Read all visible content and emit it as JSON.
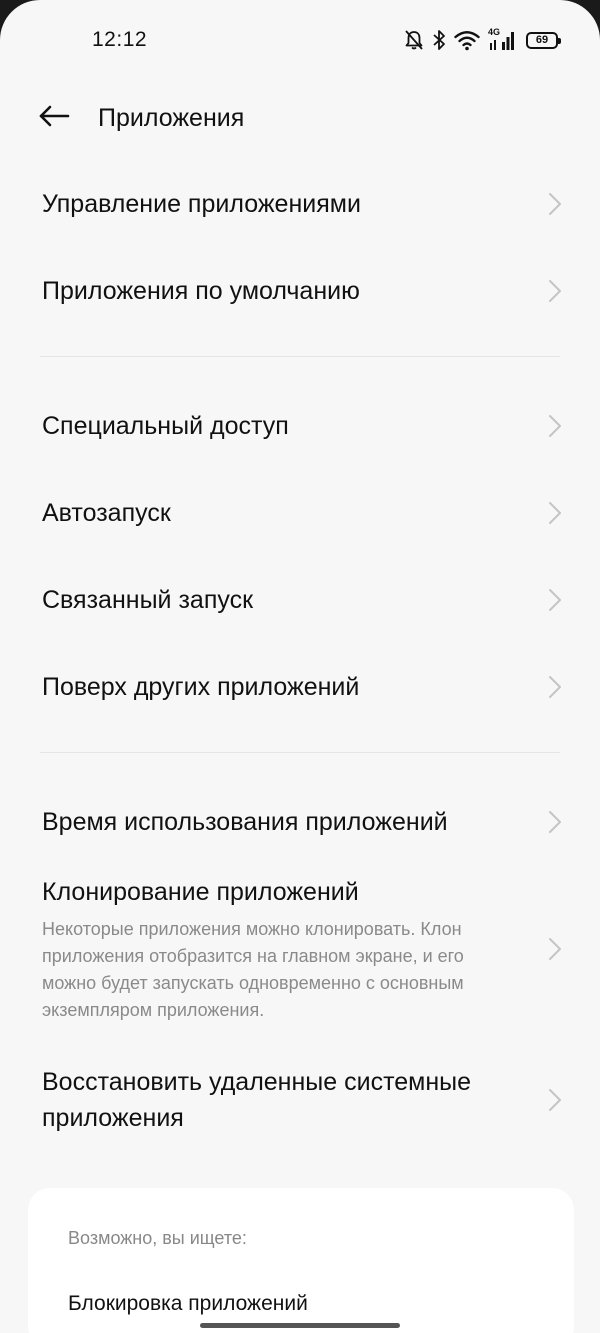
{
  "status_bar": {
    "time": "12:12",
    "network": "4G",
    "battery": "69",
    "icons": [
      "bell-off-icon",
      "bluetooth-icon",
      "wifi-icon",
      "signal-icon",
      "battery-icon"
    ]
  },
  "header": {
    "title": "Приложения",
    "back_icon": "arrow-left-icon"
  },
  "list": {
    "group1": [
      {
        "title": "Управление приложениями"
      },
      {
        "title": "Приложения по умолчанию"
      }
    ],
    "group2": [
      {
        "title": "Специальный доступ"
      },
      {
        "title": "Автозапуск"
      },
      {
        "title": "Связанный запуск"
      },
      {
        "title": "Поверх других приложений"
      }
    ],
    "group3": [
      {
        "title": "Время использования приложений"
      },
      {
        "title": "Клонирование приложений",
        "description": "Некоторые приложения можно клонировать. Клон приложения отобразится на главном экране, и его можно будет запускать одновременно с основным экземпляром приложения."
      },
      {
        "title": "Восстановить удаленные системные приложения"
      }
    ]
  },
  "suggestions": {
    "heading": "Возможно, вы ищете:",
    "items": [
      "Блокировка приложений"
    ]
  },
  "colors": {
    "background": "#f7f7f7",
    "text_primary": "#111111",
    "text_secondary": "#8a8a8a",
    "chevron": "#c4c4c4",
    "card": "#ffffff"
  }
}
